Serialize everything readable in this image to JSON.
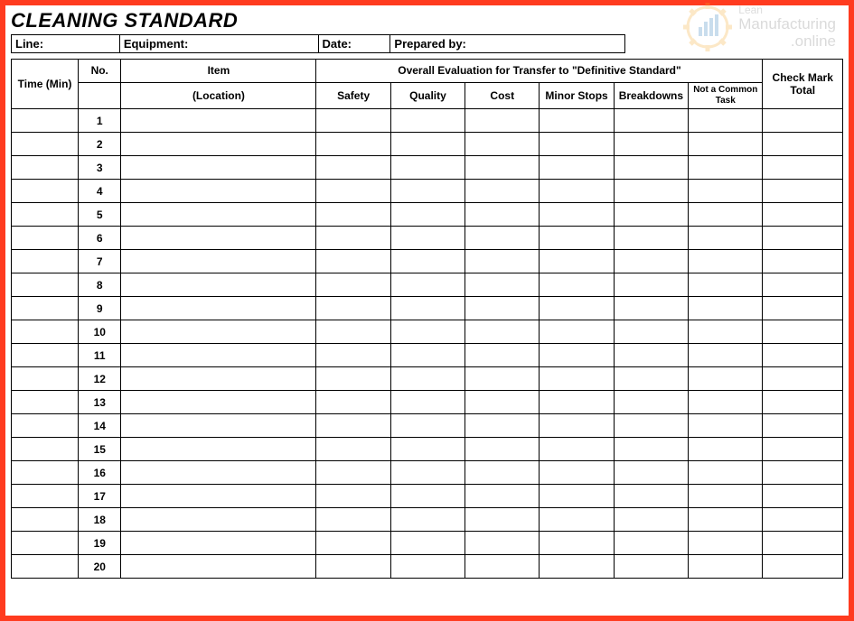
{
  "watermark": {
    "line1": "Lean",
    "line2": "Manufacturing",
    "line3": ".online"
  },
  "title": "CLEANING STANDARD",
  "meta": {
    "line_label": "Line:",
    "equipment_label": "Equipment:",
    "date_label": "Date:",
    "prepared_label": "Prepared by:"
  },
  "headers": {
    "time": "Time (Min)",
    "no": "No.",
    "item": "Item",
    "location": "(Location)",
    "overall": "Overall Evaluation for Transfer to \"Definitive Standard\"",
    "safety": "Safety",
    "quality": "Quality",
    "cost": "Cost",
    "minor": "Minor Stops",
    "breakdowns": "Breakdowns",
    "not_common": "Not a Common Task",
    "check_total": "Check Mark Total"
  },
  "rows": [
    {
      "no": "1"
    },
    {
      "no": "2"
    },
    {
      "no": "3"
    },
    {
      "no": "4"
    },
    {
      "no": "5"
    },
    {
      "no": "6"
    },
    {
      "no": "7"
    },
    {
      "no": "8"
    },
    {
      "no": "9"
    },
    {
      "no": "10"
    },
    {
      "no": "11"
    },
    {
      "no": "12"
    },
    {
      "no": "13"
    },
    {
      "no": "14"
    },
    {
      "no": "15"
    },
    {
      "no": "16"
    },
    {
      "no": "17"
    },
    {
      "no": "18"
    },
    {
      "no": "19"
    },
    {
      "no": "20"
    }
  ]
}
